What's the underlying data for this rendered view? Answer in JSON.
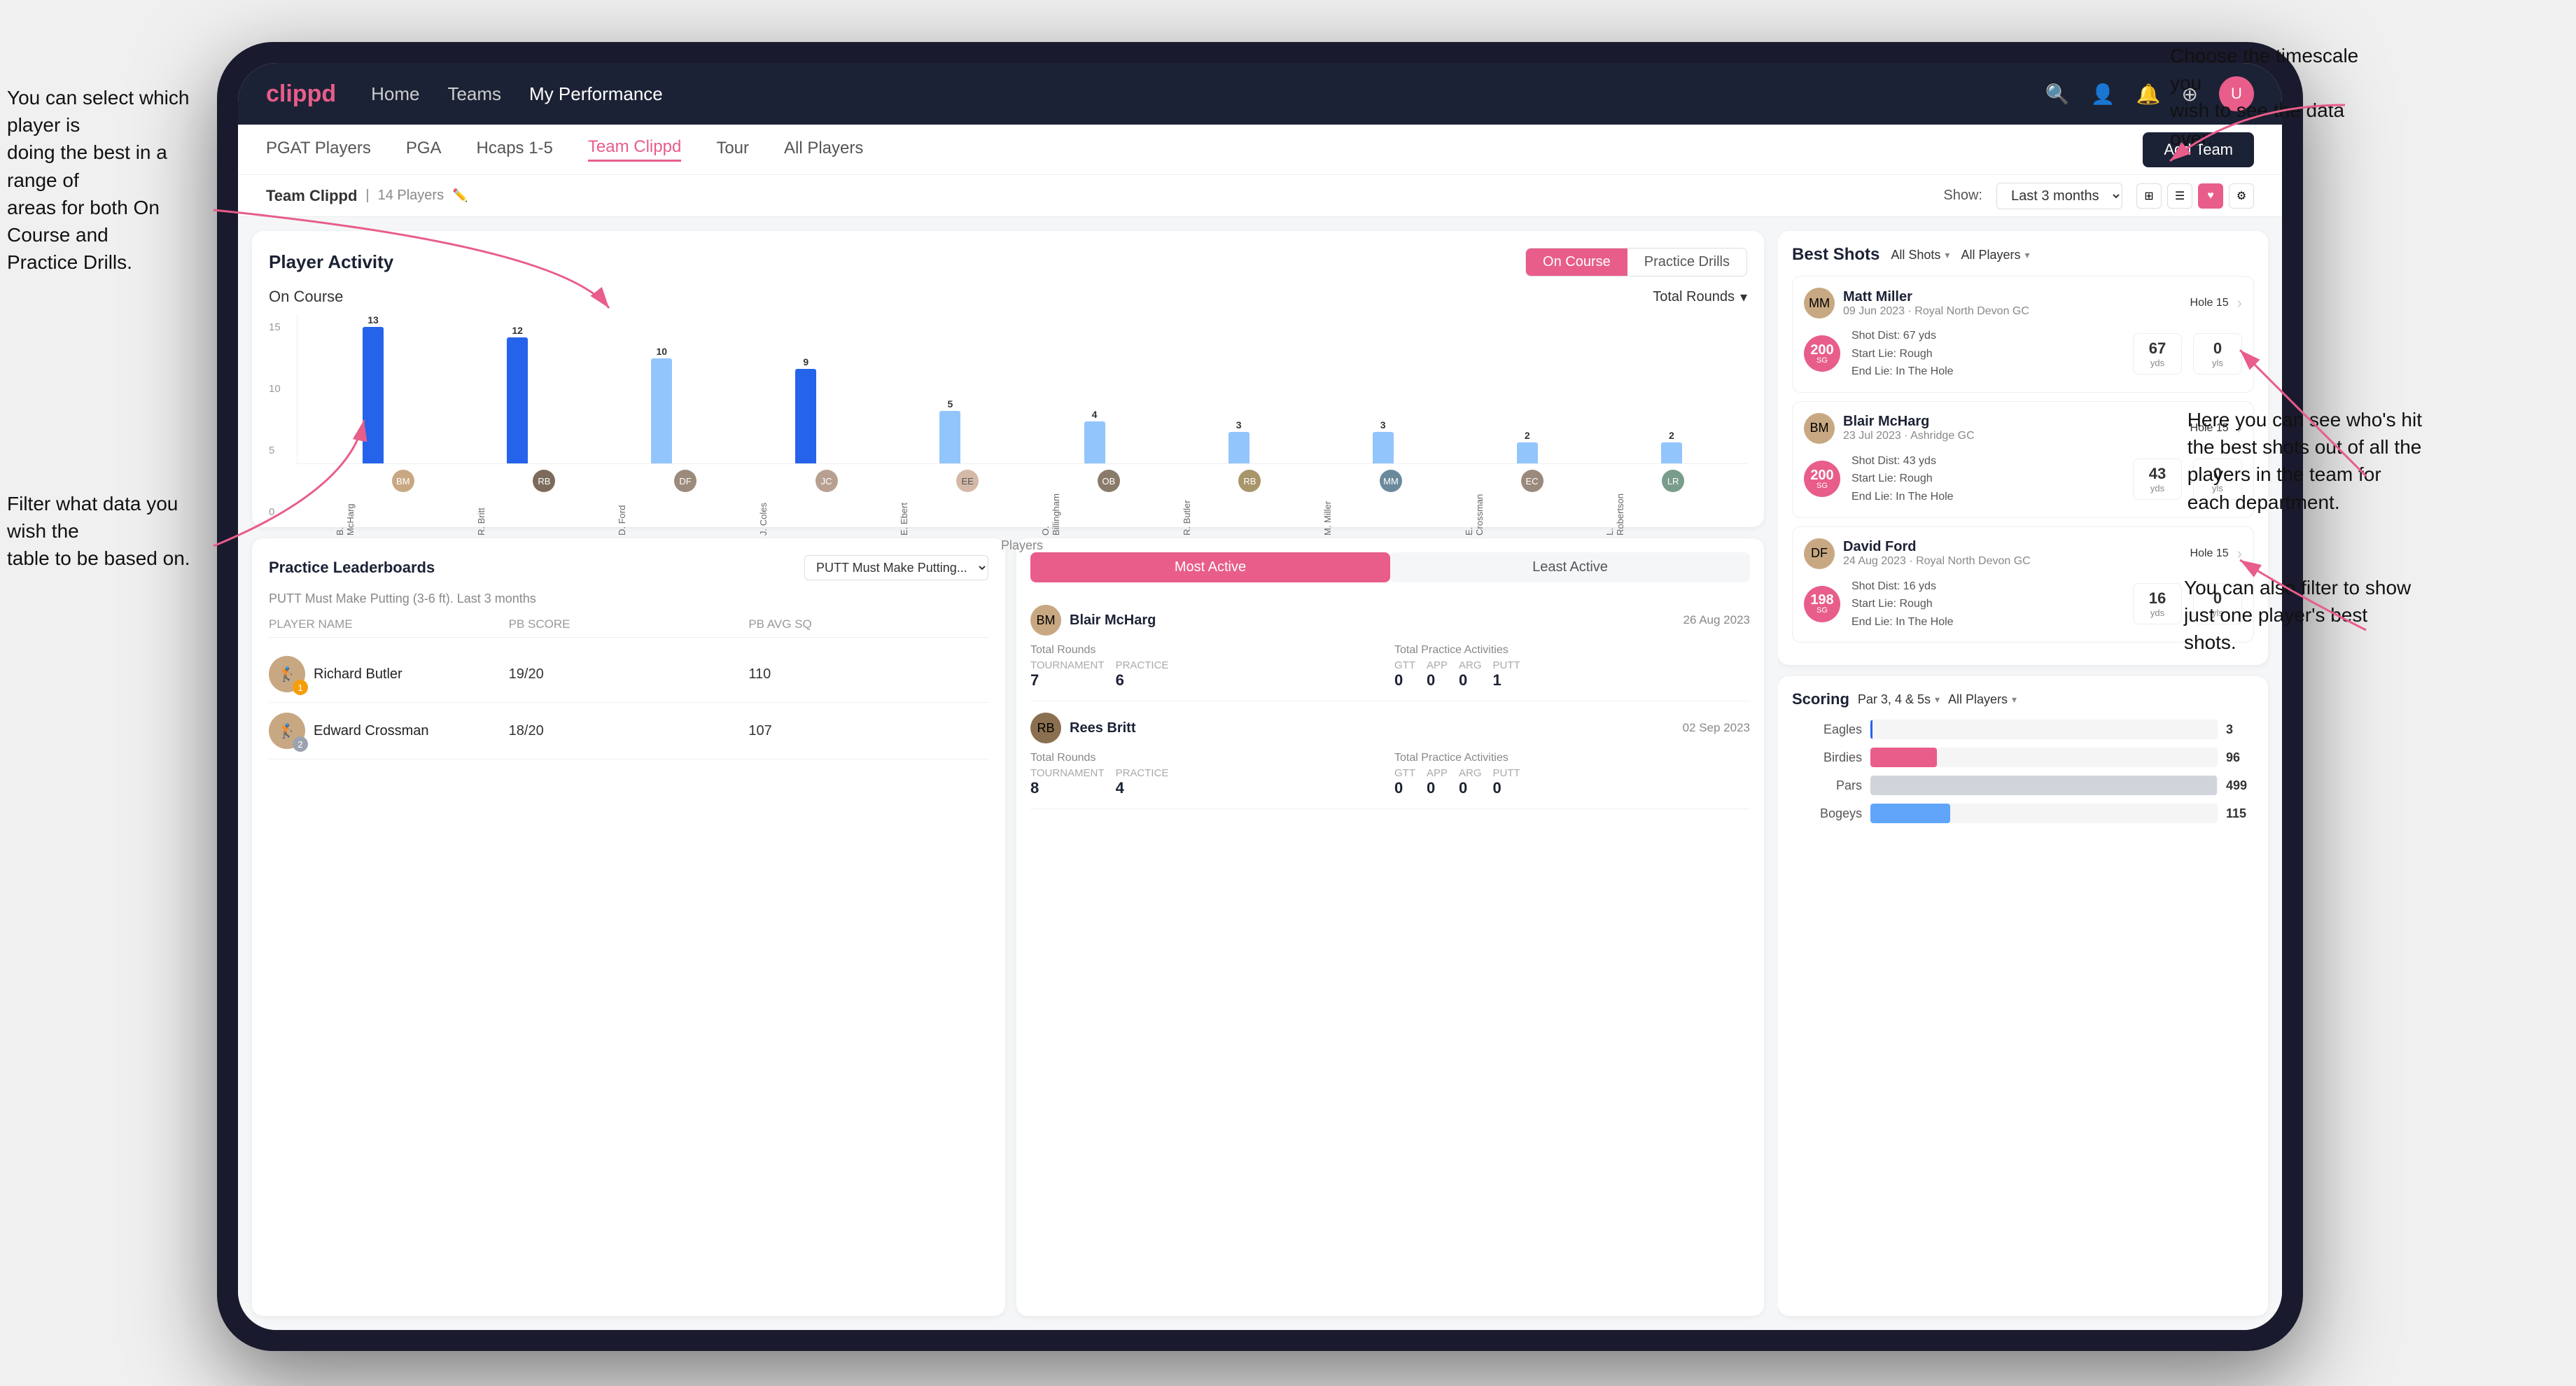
{
  "annotations": {
    "top_right": "Choose the timescale you\nwish to see the data over.",
    "left_top": "You can select which player is\ndoing the best in a range of\nareas for both On Course and\nPractice Drills.",
    "left_bottom": "Filter what data you wish the\ntable to be based on.",
    "right_mid": "Here you can see who's hit\nthe best shots out of all the\nplayers in the team for\neach department.",
    "right_bottom": "You can also filter to show\njust one player's best shots."
  },
  "nav": {
    "logo": "clippd",
    "links": [
      "Home",
      "Teams",
      "My Performance"
    ],
    "active_link": "My Performance"
  },
  "sub_nav": {
    "links": [
      "PGAT Players",
      "PGA",
      "Hcaps 1-5",
      "Team Clippd",
      "Tour",
      "All Players"
    ],
    "active_link": "Team Clippd",
    "add_btn": "Add Team"
  },
  "team_header": {
    "title": "Team Clippd",
    "count": "14 Players",
    "show_label": "Show:",
    "time_filter": "Last 3 months"
  },
  "player_activity": {
    "title": "Player Activity",
    "tabs": [
      "On Course",
      "Practice Drills"
    ],
    "active_tab": "On Course",
    "chart_label": "On Course",
    "chart_dropdown": "Total Rounds",
    "y_axis_labels": [
      "15",
      "10",
      "5",
      "0"
    ],
    "bars": [
      {
        "name": "B. McHarg",
        "value": 13,
        "height": 195
      },
      {
        "name": "R. Britt",
        "value": 12,
        "height": 180
      },
      {
        "name": "D. Ford",
        "value": 10,
        "height": 150
      },
      {
        "name": "J. Coles",
        "value": 9,
        "height": 135
      },
      {
        "name": "E. Ebert",
        "value": 5,
        "height": 75
      },
      {
        "name": "O. Billingham",
        "value": 4,
        "height": 60
      },
      {
        "name": "R. Butler",
        "value": 3,
        "height": 45
      },
      {
        "name": "M. Miller",
        "value": 3,
        "height": 45
      },
      {
        "name": "E. Crossman",
        "value": 2,
        "height": 30
      },
      {
        "name": "L. Robertson",
        "value": 2,
        "height": 30
      }
    ],
    "x_axis_label": "Players"
  },
  "practice_leaderboards": {
    "title": "Practice Leaderboards",
    "dropdown": "PUTT Must Make Putting...",
    "subtitle": "PUTT Must Make Putting (3-6 ft). Last 3 months",
    "columns": [
      "PLAYER NAME",
      "PB SCORE",
      "PB AVG SQ"
    ],
    "players": [
      {
        "name": "Richard Butler",
        "rank": 1,
        "pb_score": "19/20",
        "pb_avg": "110",
        "rank_color": "gold"
      },
      {
        "name": "Edward Crossman",
        "rank": 2,
        "pb_score": "18/20",
        "pb_avg": "107",
        "rank_color": "silver"
      }
    ]
  },
  "best_shots": {
    "title": "Best Shots",
    "filter1": "All Shots",
    "filter2": "All Players",
    "players": [
      {
        "name": "Matt Miller",
        "date": "09 Jun 2023",
        "course": "Royal North Devon GC",
        "hole": "Hole 15",
        "badge_num": "200",
        "badge_label": "SG",
        "shot_dist": "Shot Dist: 67 yds",
        "start_lie": "Start Lie: Rough",
        "end_lie": "End Lie: In The Hole",
        "stat1": "67",
        "stat1_label": "yds",
        "stat2": "0",
        "stat2_label": "yls"
      },
      {
        "name": "Blair McHarg",
        "date": "23 Jul 2023",
        "course": "Ashridge GC",
        "hole": "Hole 15",
        "badge_num": "200",
        "badge_label": "SG",
        "shot_dist": "Shot Dist: 43 yds",
        "start_lie": "Start Lie: Rough",
        "end_lie": "End Lie: In The Hole",
        "stat1": "43",
        "stat1_label": "yds",
        "stat2": "0",
        "stat2_label": "yls"
      },
      {
        "name": "David Ford",
        "date": "24 Aug 2023",
        "course": "Royal North Devon GC",
        "hole": "Hole 15",
        "badge_num": "198",
        "badge_label": "SG",
        "shot_dist": "Shot Dist: 16 yds",
        "start_lie": "Start Lie: Rough",
        "end_lie": "End Lie: In The Hole",
        "stat1": "16",
        "stat1_label": "yds",
        "stat2": "0",
        "stat2_label": "yls"
      }
    ]
  },
  "most_active": {
    "tabs": [
      "Most Active",
      "Least Active"
    ],
    "active_tab": "Most Active",
    "players": [
      {
        "name": "Blair McHarg",
        "date": "26 Aug 2023",
        "total_rounds_label": "Total Rounds",
        "tournament": "7",
        "practice": "6",
        "practice_activities_label": "Total Practice Activities",
        "gtt": "0",
        "app": "0",
        "arg": "0",
        "putt": "1"
      },
      {
        "name": "Rees Britt",
        "date": "02 Sep 2023",
        "total_rounds_label": "Total Rounds",
        "tournament": "8",
        "practice": "4",
        "practice_activities_label": "Total Practice Activities",
        "gtt": "0",
        "app": "0",
        "arg": "0",
        "putt": "0"
      }
    ]
  },
  "scoring": {
    "title": "Scoring",
    "filter1": "Par 3, 4 & 5s",
    "filter2": "All Players",
    "rows": [
      {
        "label": "Eagles",
        "value": 3,
        "max": 500,
        "color": "eagles"
      },
      {
        "label": "Birdies",
        "value": 96,
        "max": 500,
        "color": "birdies"
      },
      {
        "label": "Pars",
        "value": 499,
        "max": 500,
        "color": "pars"
      },
      {
        "label": "Bogeys",
        "value": 115,
        "max": 500,
        "color": "bogeys"
      }
    ]
  }
}
